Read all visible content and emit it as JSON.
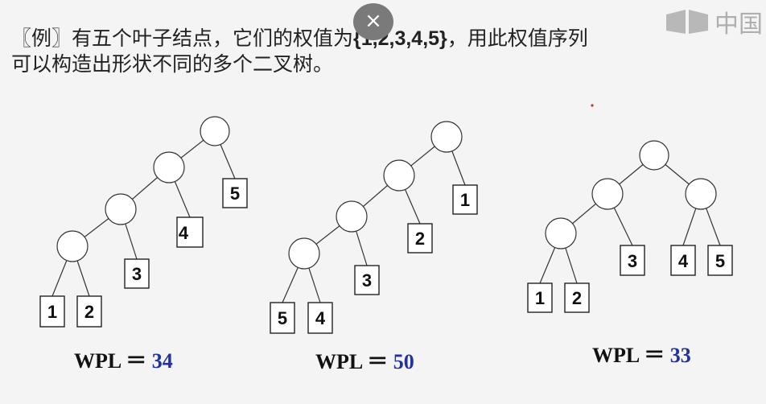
{
  "intro": {
    "prefix": "〖例〗有五个叶子结点，它们的权值为",
    "weights": "{1,2,3,4,5}",
    "suffix": "，用此权值序列",
    "line2": "可以构造出形状不同的多个二叉树。"
  },
  "ui": {
    "close_glyph": "×",
    "brand_text": "中国"
  },
  "trees": [
    {
      "leaves": [
        "1",
        "2",
        "3",
        "4",
        "5"
      ],
      "wpl_label": "WPL ＝",
      "wpl_value": "34"
    },
    {
      "leaves": [
        "5",
        "4",
        "3",
        "2",
        "1"
      ],
      "wpl_label": "WPL ＝",
      "wpl_value": "50"
    },
    {
      "leaves": [
        "1",
        "2",
        "3",
        "4",
        "5"
      ],
      "wpl_label": "WPL ＝",
      "wpl_value": "33"
    }
  ],
  "colors": {
    "wpl_value": "#2230a0",
    "background": "#f4f4f4"
  }
}
